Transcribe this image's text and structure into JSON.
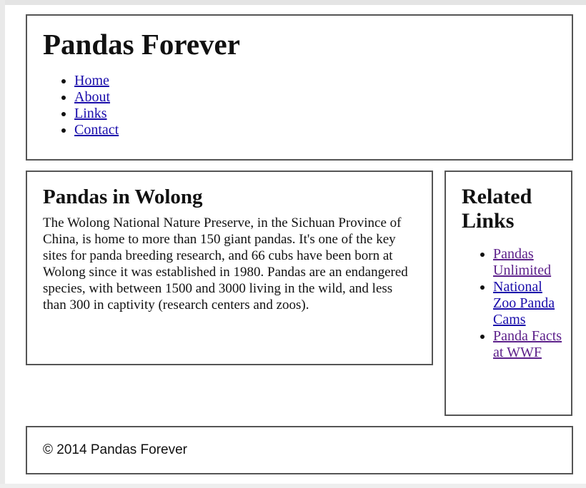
{
  "header": {
    "site_title": "Pandas Forever",
    "nav": [
      {
        "label": "Home"
      },
      {
        "label": "About"
      },
      {
        "label": "Links"
      },
      {
        "label": "Contact"
      }
    ]
  },
  "article": {
    "title": "Pandas in Wolong",
    "body": "The Wolong National Nature Preserve, in the Sichuan Province of China, is home to more than 150 giant pandas. It's one of the key sites for panda breeding research, and 66 cubs have been born at Wolong since it was established in 1980. Pandas are an endangered species, with between 1500 and 3000 living in the wild, and less than 300 in captivity (research centers and zoos)."
  },
  "sidebar": {
    "title": "Related Links",
    "links": [
      {
        "label": "Pandas Unlimited"
      },
      {
        "label": "National Zoo Panda Cams"
      },
      {
        "label": "Panda Facts at WWF"
      }
    ]
  },
  "footer": {
    "text": "© 2014 Pandas Forever"
  },
  "colors": {
    "link": "#1a0dab",
    "visited_link": "#5c1f8a",
    "border": "#555555"
  }
}
